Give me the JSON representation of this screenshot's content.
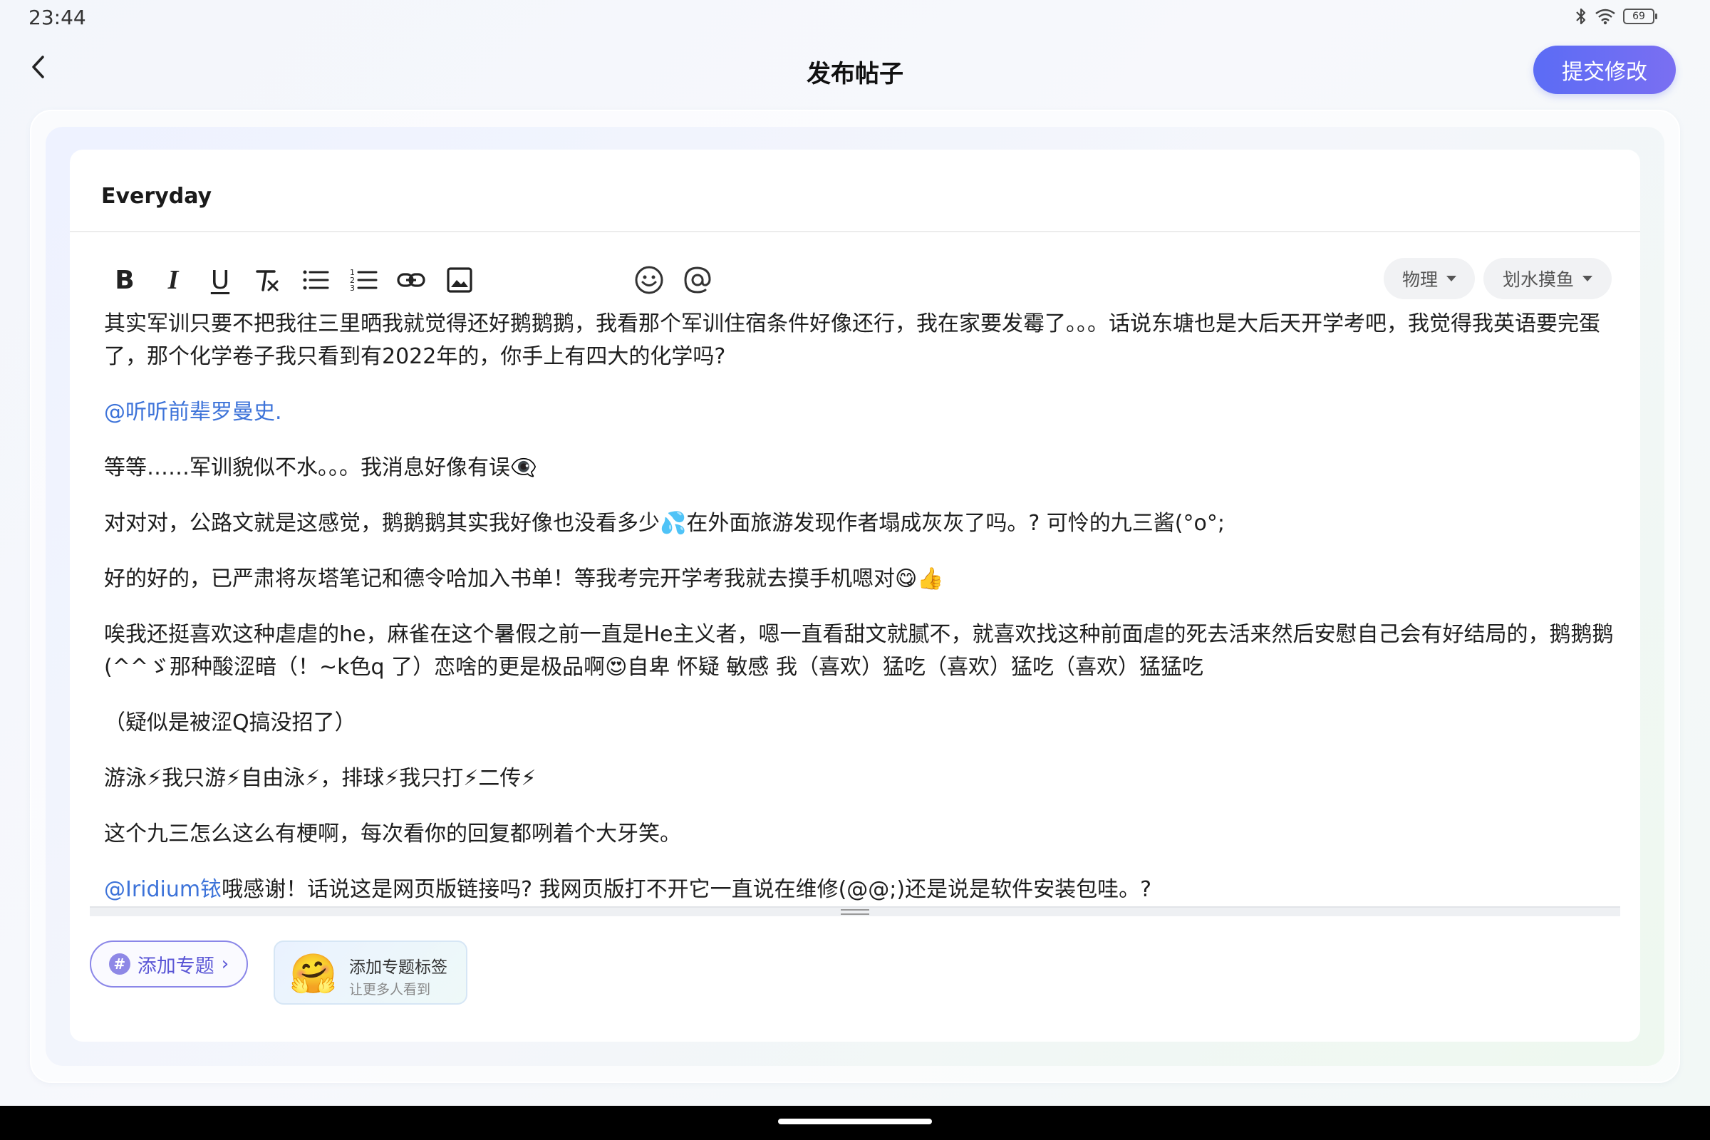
{
  "status_bar": {
    "time": "23:44",
    "battery": "69",
    "icons": [
      "bluetooth-icon",
      "wifi-icon",
      "battery-icon"
    ]
  },
  "header": {
    "title": "发布帖子",
    "submit_label": "提交修改"
  },
  "editor": {
    "title_value": "Everyday",
    "toolbar": {
      "bold": "B",
      "italic": "I",
      "underline": "U",
      "icons": [
        "bold-icon",
        "italic-icon",
        "underline-icon",
        "clear-format-icon",
        "bullet-list-icon",
        "numbered-list-icon",
        "link-icon",
        "image-icon",
        "emoji-icon",
        "mention-icon"
      ]
    },
    "tags": {
      "category": "物理",
      "subcategory": "划水摸鱼"
    },
    "content": {
      "p1": "其实军训只要不把我往三里晒我就觉得还好鹅鹅鹅，我看那个军训住宿条件好像还行，我在家要发霉了。。。话说东塘也是大后天开学考吧，我觉得我英语要完蛋了，那个化学卷子我只看到有2022年的，你手上有四大的化学吗?",
      "p2_mention": "@听听前辈罗曼史.",
      "p3": "等等……军训貌似不水。。。我消息好像有误👁‍🗨",
      "p4": "对对对，公路文就是这感觉，鹅鹅鹅其实我好像也没看多少💦在外面旅游发现作者塌成灰灰了吗。? 可怜的九三酱(°o°;",
      "p5": "好的好的，已严肃将灰塔笔记和德令哈加入书单！等我考完开学考我就去摸手机嗯对😋👍",
      "p6": "唉我还挺喜欢这种虐虐的he，麻雀在这个暑假之前一直是He主义者，嗯一直看甜文就腻不，就喜欢找这种前面虐的死去活来然后安慰自己会有好结局的，鹅鹅鹅(^^ゞ那种酸涩暗（！~k色q 了）恋啥的更是极品啊😍自卑 怀疑 敏感 我（喜欢）猛吃（喜欢）猛吃（喜欢）猛猛吃",
      "p7": "（疑似是被涩Q搞没招了）",
      "p8": "游泳⚡我只游⚡自由泳⚡，排球⚡我只打⚡二传⚡",
      "p9": "这个九三怎么这么有梗啊，每次看你的回复都咧着个大牙笑。",
      "p10_mention": "@Iridium铱",
      "p10_text": "哦感谢！话说这是网页版链接吗? 我网页版打不开它一直说在维修(@@;)还是说是软件安装包哇。?"
    },
    "add_topic_label": "添加专题",
    "tip": {
      "emoji": "🤗",
      "title": "添加专题标签",
      "subtitle": "让更多人看到"
    }
  },
  "colors": {
    "accent": "#5b6cf5",
    "mention": "#3d73d9",
    "topic": "#5b57d6"
  }
}
